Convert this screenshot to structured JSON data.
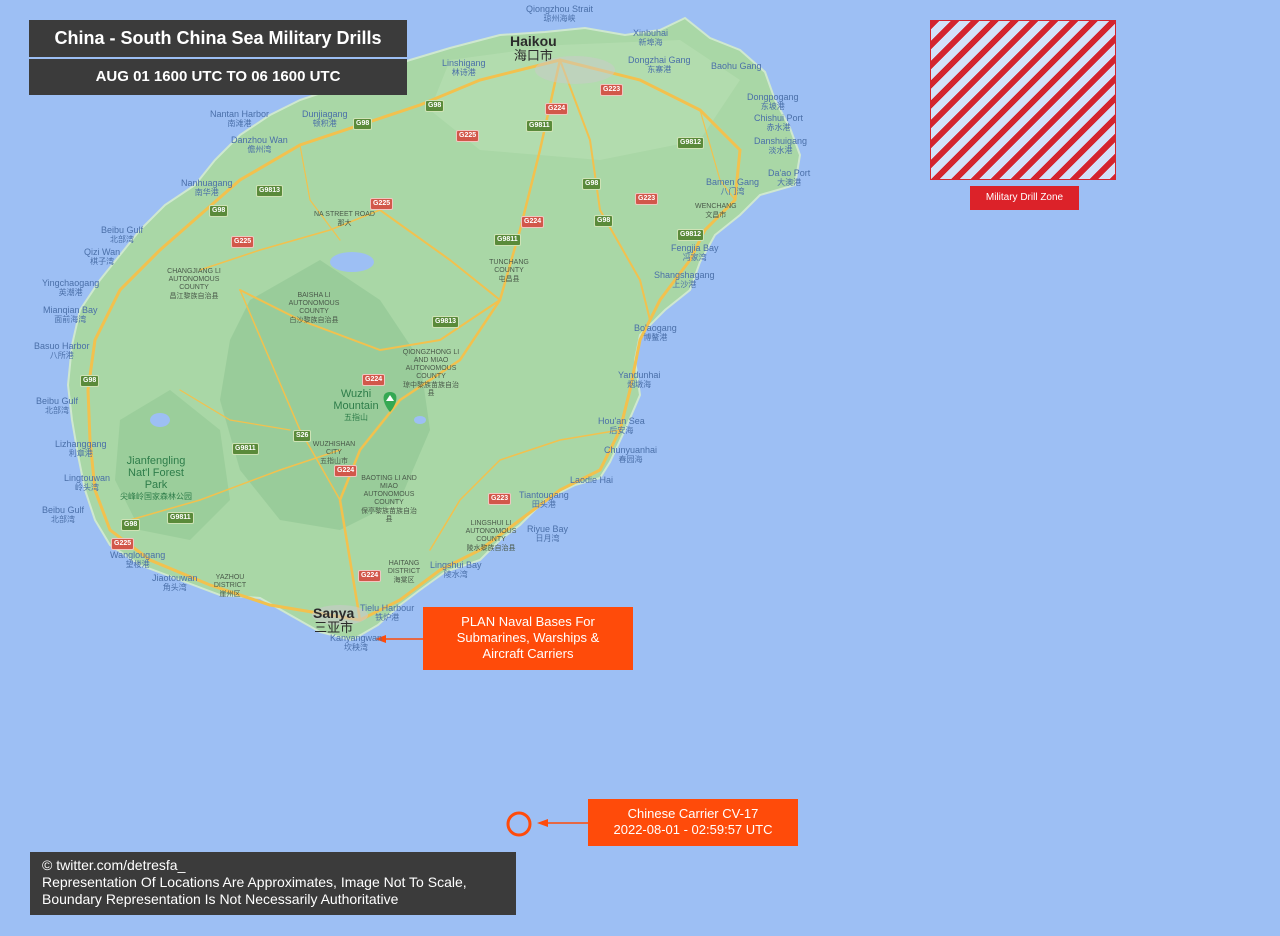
{
  "header": {
    "title": "China - South China Sea Military Drills",
    "date_range": "AUG 01 1600 UTC TO 06 1600 UTC"
  },
  "legend": {
    "label": "Military Drill Zone",
    "hatch_color": "#d4242e",
    "label_color": "#dc2229"
  },
  "callouts": {
    "naval_bases": "PLAN Naval Bases For\nSubmarines, Warships &\nAircraft Carriers",
    "carrier_line1": "Chinese Carrier CV-17",
    "carrier_line2": "2022-08-01 - 02:59:57 UTC",
    "color": "#ff4b0a"
  },
  "credit": {
    "line1": "© twitter.com/detresfa_",
    "line2": "Representation Of Locations Are Approximates, Image Not To Scale,",
    "line3": "Boundary Representation Is Not Necessarily Authoritative"
  },
  "map_colors": {
    "sea": "#9dbff4",
    "land": "#a9d7a6",
    "road": "#f2c14e",
    "marker": "#34a853"
  },
  "map_labels": {
    "cities": [
      {
        "en": "Haikou",
        "zh": "海口市"
      },
      {
        "en": "Sanya",
        "zh": "三亚市"
      }
    ],
    "places": [
      {
        "en": "Qiongzhou Strait",
        "zh": "琼州海峡"
      },
      {
        "en": "Xinbuhai",
        "zh": "新埠海"
      },
      {
        "en": "Dongzhai Gang",
        "zh": "东寨港"
      },
      {
        "en": "Baohu Gang",
        "zh": ""
      },
      {
        "en": "Dongpogang",
        "zh": "东坡港"
      },
      {
        "en": "Chishui Port",
        "zh": "赤水港"
      },
      {
        "en": "Danshuigang",
        "zh": "淡水港"
      },
      {
        "en": "Bamen Gang",
        "zh": "八门湾"
      },
      {
        "en": "Da'ao Port",
        "zh": "大澳港"
      },
      {
        "en": "WENCHANG",
        "zh": "文昌市"
      },
      {
        "en": "Fengjia Bay",
        "zh": "冯家湾"
      },
      {
        "en": "Shangshagang",
        "zh": "上沙港"
      },
      {
        "en": "Bo'aogang",
        "zh": "博鳌港"
      },
      {
        "en": "Yandunhai",
        "zh": "烟墩海"
      },
      {
        "en": "Hou'an Sea",
        "zh": "后安海"
      },
      {
        "en": "Chunyuanhai",
        "zh": "春园海"
      },
      {
        "en": "Laodie Hai",
        "zh": ""
      },
      {
        "en": "Tiantougang",
        "zh": "田头港"
      },
      {
        "en": "Riyue Bay",
        "zh": "日月湾"
      },
      {
        "en": "Lingshui Bay",
        "zh": "陵水湾"
      },
      {
        "en": "Tielu Harbour",
        "zh": "铁炉港"
      },
      {
        "en": "Kanyangwan",
        "zh": "坎秧湾"
      },
      {
        "en": "Jiaotouwan",
        "zh": "角头湾"
      },
      {
        "en": "Wanglougang",
        "zh": "望楼港"
      },
      {
        "en": "Beibu Gulf",
        "zh": "北部湾"
      },
      {
        "en": "Lingtouwan",
        "zh": "岭头湾"
      },
      {
        "en": "Lizhanggang",
        "zh": "利章港"
      },
      {
        "en": "Basuo Harbor",
        "zh": "八所港"
      },
      {
        "en": "Mianqian Bay",
        "zh": "面前海湾"
      },
      {
        "en": "Yingchaogang",
        "zh": "英潮港"
      },
      {
        "en": "Qizi Wan",
        "zh": "棋子湾"
      },
      {
        "en": "Nanhuagang",
        "zh": "南华港"
      },
      {
        "en": "Danzhou Wan",
        "zh": "儋州湾"
      },
      {
        "en": "Nantan Harbor",
        "zh": "南滩港"
      },
      {
        "en": "Dunjiagang",
        "zh": "顿积港"
      },
      {
        "en": "Linshigang",
        "zh": "林诗港"
      }
    ],
    "counties": [
      {
        "en": "NA STREET ROAD",
        "zh": "那大"
      },
      {
        "en": "TUNCHANG COUNTY",
        "zh": "屯昌县"
      },
      {
        "en": "CHANGJIANG LI AUTONOMOUS COUNTY",
        "zh": "昌江黎族自治县"
      },
      {
        "en": "BAISHA LI AUTONOMOUS COUNTY",
        "zh": "白沙黎族自治县"
      },
      {
        "en": "QIONGZHONG LI AND MIAO AUTONOMOUS COUNTY",
        "zh": "琼中黎族苗族自治县"
      },
      {
        "en": "WUZHISHAN CITY",
        "zh": "五指山市"
      },
      {
        "en": "BAOTING LI AND MIAO AUTONOMOUS COUNTY",
        "zh": "保亭黎族苗族自治县"
      },
      {
        "en": "LINGSHUI LI AUTONOMOUS COUNTY",
        "zh": "陵水黎族自治县"
      },
      {
        "en": "HAITANG DISTRICT",
        "zh": "海棠区"
      },
      {
        "en": "YAZHOU DISTRICT",
        "zh": "崖州区"
      }
    ],
    "parks": [
      {
        "en": "Jianfengling Nat'l Forest Park",
        "zh": "尖峰岭国家森林公园"
      },
      {
        "en": "Wuzhi Mountain",
        "zh": "五指山"
      }
    ],
    "highways": [
      "G223",
      "G224",
      "G225",
      "G98",
      "G9811",
      "G9812",
      "G9813",
      "S26"
    ]
  }
}
